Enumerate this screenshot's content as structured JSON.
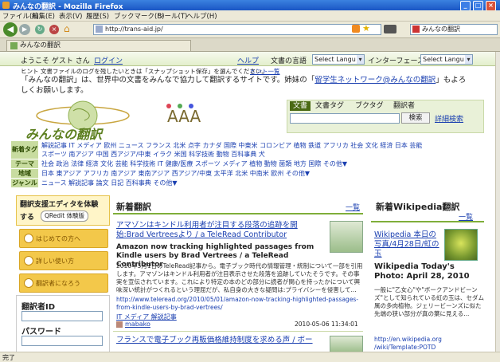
{
  "window": {
    "title": "みんなの翻訳 - Mozilla Firefox"
  },
  "menu": [
    "ファイル(F)",
    "編集(E)",
    "表示(V)",
    "履歴(S)",
    "ブックマーク(B)",
    "ツール(T)",
    "ヘルプ(H)"
  ],
  "nav": {
    "url": "http://trans-aid.jp/",
    "search_value": "みんなの翻訳"
  },
  "tab": {
    "label": "みんなの翻訳"
  },
  "page": {
    "welcome": "ようこそ ゲスト さん",
    "login": "ログイン",
    "help": "ヘルプ",
    "doc_lang_label": "文書の言語",
    "doc_lang_select": "Select Langu",
    "interface_label": "インターフェース",
    "interface_select": "Select Langu",
    "hint": "ヒント  文書ファイルのログを残したいときは「スナップショット保存」を選んでください。",
    "hint_link": "ヒント一覧",
    "intro_1": "「みんなの翻訳」は、世界中の文書をみんなで協力して翻訳するサイトです。姉妹の「",
    "intro_link": "留学生ネットワーク@みんなの翻訳",
    "intro_2": "」もよろしくお願いします。",
    "logo_text": "みんなの翻訳",
    "search_tabs": [
      "文書",
      "文書タグ",
      "ブクタグ",
      "翻訳者"
    ],
    "search_button": "検索",
    "advanced_search": "詳細検索",
    "tag_rows": [
      {
        "label": "新着タグ",
        "text": "解説記事 IT メディア 欧州 ニュース フランス 北米 点字 カナダ 国際 中東米 コロンビア 植物 鉄道 アフリカ 社会 文化 経済 日本 芸能"
      },
      {
        "label": "",
        "text": "スポーツ 南アジア 中国 西アジア/中東 イラク 米国 科学技術 動物 百科事典 犬"
      },
      {
        "label": "テーマ",
        "text": "社会 政治 法律 経済 文化 芸能 科学技術 IT 健康/医療 スポーツ メディア 植物 動物 菌類 地方 国際 その他▼"
      },
      {
        "label": "地域",
        "text": "日本 東アジア アフリカ 南アジア 東南アジア 西アジア/中東 太平洋 北米 中南米 欧州 その他▼"
      },
      {
        "label": "ジャンル",
        "text": "ニュース 解説記事 論文 日記 百科事典 その他▼"
      }
    ],
    "editor_promo": {
      "line1": "翻訳支援エディタを体験",
      "line2": "する",
      "badge": "QRedit 体験版"
    },
    "side_buttons": [
      "はじめての方へ",
      "詳しい使い方",
      "翻訳者になろう"
    ],
    "translator_id_label": "翻訳者ID",
    "password_label": "パスワード",
    "new_translations": {
      "title": "新着翻訳",
      "more": "一覧",
      "item1": {
        "title_ja": "アマゾンはキンドル利用者が注目する段落の追跡を開始:Brad Vertreesより / a TeleRead Contributor",
        "title_en": "Amazon now tracking highlighted passages from Kindle users by Brad Vertrees / a TeleRead Contributor",
        "body": "2010年5月1日のTeleRead記事から。電子ブック時代の情報管理・統制について一部を引用します。アマゾンはキンドル利用者が注目表示させた段落を追跡していたそうです。その事実を宣伝されています。これにより特定の本のどの部分に読者が関心を持ったかについて興味深い統計がつくれるという理屈だが、私自身の大きな疑問は:プライバシーを侵害して...",
        "url": "http://www.teleread.org/2010/05/01/amazon-now-tracking-highlighted-passages-from-kindle-users-by-brad-vertrees/",
        "tags": "IT メディア 解説記事",
        "user": "mabako",
        "date": "2010-05-06 11:34:01"
      },
      "item2": {
        "title_ja": "フランスで電子ブック再販価格維持制度を求める声 / ボー"
      }
    },
    "wikipedia": {
      "title": "新着Wikipedia翻訳",
      "more": "一覧",
      "photo_ja": "Wikipedia 本日の写真/4月28日/虹の玉",
      "photo_en": "Wikipedia Today's Photo: April 28, 2010",
      "body": "一般に\"乙女心\"や\"ボークアンドビーンズ\"として知られている虹の玉は、セダム属の多肉植物。ジェリービーンズに似た先端の狭い部分が真の葉に見える...",
      "url": "http://en.wikipedia.org",
      "url2": "/wiki/Template:POTD"
    }
  },
  "status": "完了"
}
